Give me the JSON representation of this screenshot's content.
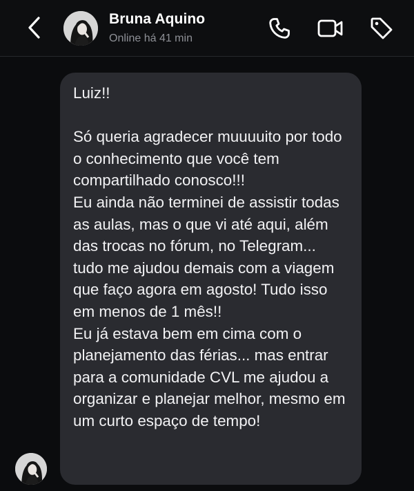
{
  "header": {
    "contact_name": "Bruna Aquino",
    "status": "Online há 41 min",
    "back_icon": "chevron-left-icon",
    "actions": [
      "phone-icon",
      "video-icon",
      "tag-icon"
    ]
  },
  "message": {
    "text": "Luiz!!\n\nSó queria agradecer muuuuito por todo o conhecimento que você tem compartilhado conosco!!!\nEu ainda não terminei de assistir todas as aulas, mas o que vi até aqui, além das trocas no fórum, no Telegram... tudo me ajudou demais com a viagem que faço agora em agosto! Tudo isso em menos de 1 mês!!\nEu já estava bem em cima com o planejamento das férias... mas entrar para a comunidade CVL me ajudou a organizar e planejar melhor, mesmo em um curto espaço de tempo!"
  },
  "colors": {
    "background": "#0b0c0e",
    "bubble": "#2a2b30",
    "text": "#f2f2f4",
    "status_text": "#8e9096"
  }
}
